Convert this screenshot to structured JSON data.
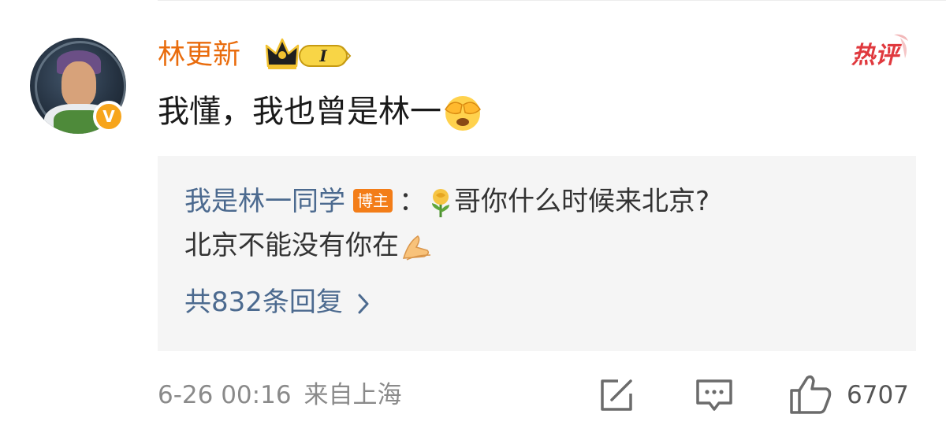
{
  "comment": {
    "username": "林更新",
    "level": "I",
    "hot_tag": "热评",
    "text": "我懂，我也曾是林一",
    "verified_mark": "V"
  },
  "reply": {
    "username": "我是林一同学",
    "badge": "博主",
    "separator": "：",
    "text_line1": "哥你什么时候来北京?",
    "text_line2": "北京不能没有你在",
    "more_label": "共832条回复"
  },
  "footer": {
    "datetime": "6-26 00:16",
    "location": "来自上海",
    "like_count": "6707"
  },
  "colors": {
    "username": "#e96c0d",
    "link_blue": "#4c6a8f",
    "hot_red": "#e0393e",
    "blogger_orange": "#f37d18"
  },
  "icons": [
    "v-verified-icon",
    "crown-icon",
    "see-no-evil-emoji",
    "rose-emoji",
    "pray-hands-emoji",
    "chevron-right-icon",
    "share-icon",
    "comment-icon",
    "thumbs-up-icon"
  ]
}
